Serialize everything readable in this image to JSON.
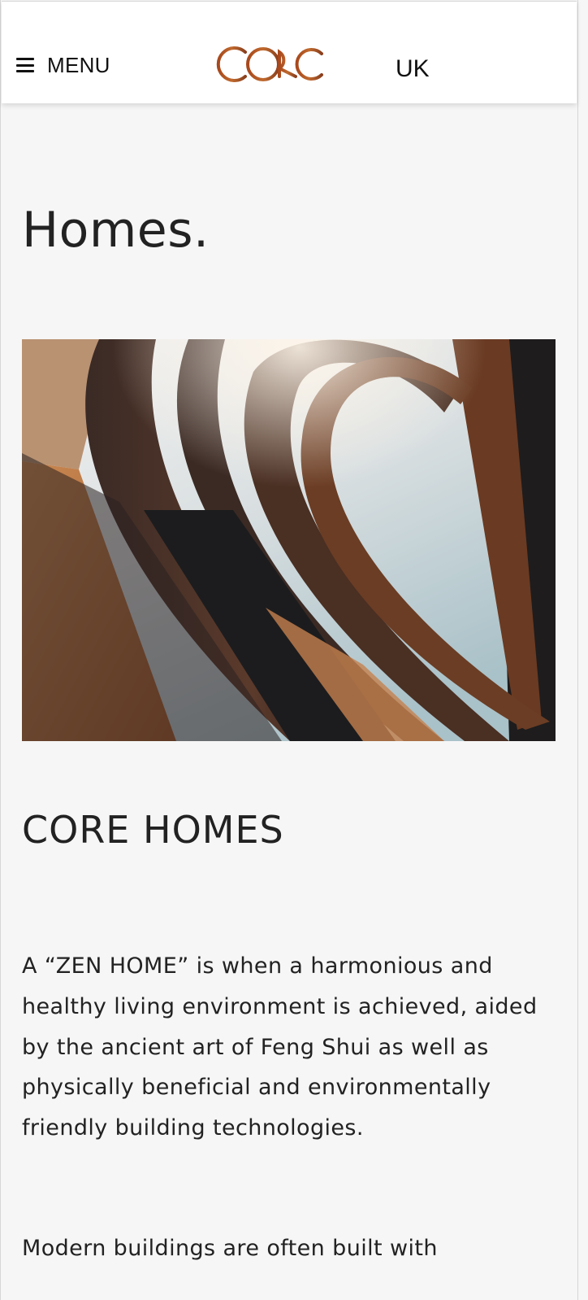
{
  "header": {
    "menu_label": "MENU",
    "logo_text": "CORE",
    "region_label": "UK"
  },
  "main": {
    "page_title": "Homes.",
    "section_heading": "CORE HOMES",
    "paragraph_1": "A “ZEN HOME” is when a harmonious and healthy living environment is achieved, aided by the ancient art of Feng Shui as well as physically beneficial and environmentally friendly building technologies.",
    "paragraph_2_visible": "Modern buildings are often built with"
  },
  "colors": {
    "background": "#f6f6f6",
    "header_bg": "#ffffff",
    "logo_gradient_start": "#b0561f",
    "logo_gradient_end": "#7a3a1c",
    "text": "#222222"
  },
  "icons": {
    "menu": "hamburger-icon"
  }
}
